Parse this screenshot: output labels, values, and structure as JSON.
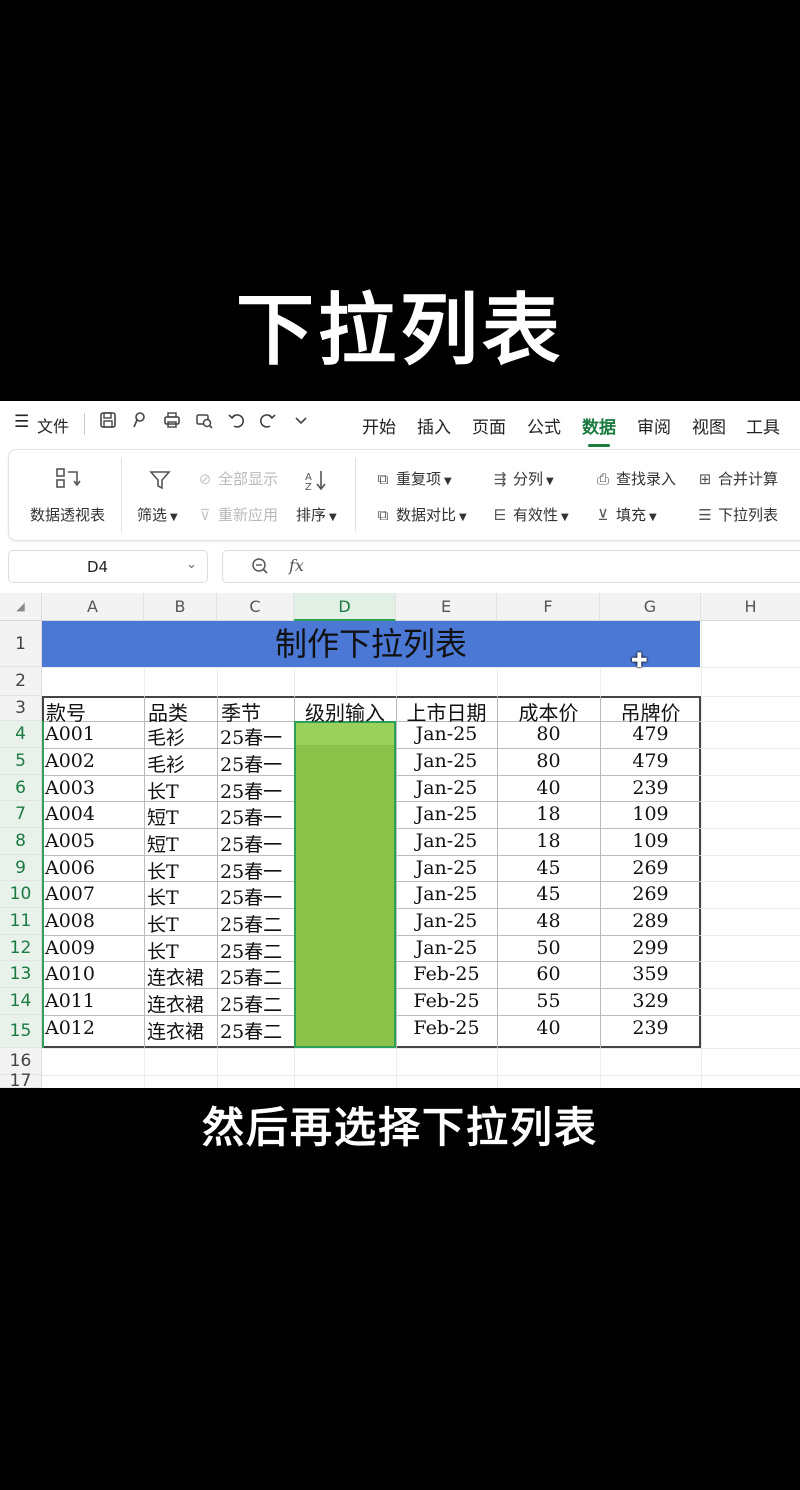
{
  "headline": "下拉列表",
  "subtitle": "然后再选择下拉列表",
  "menubar": {
    "menu_icon": "☰",
    "file_label": "文件",
    "quick_icons": [
      "save-icon",
      "format-painter-icon",
      "print-icon",
      "print-preview-icon",
      "undo-icon",
      "redo-icon",
      "more-icon"
    ],
    "tabs": [
      "开始",
      "插入",
      "页面",
      "公式",
      "数据",
      "审阅",
      "视图",
      "工具"
    ],
    "active_tab": "数据"
  },
  "ribbon": {
    "pivot": "数据透视表",
    "filter": "筛选",
    "show_all": "全部显示",
    "reapply": "重新应用",
    "sort": "排序",
    "duplicates": "重复项",
    "compare": "数据对比",
    "split": "分列",
    "validity": "有效性",
    "lookup_entry": "查找录入",
    "fill": "填充",
    "merge_calc": "合并计算",
    "dropdown_list": "下拉列表"
  },
  "formula_bar": {
    "cell_ref": "D4",
    "fx": "fx",
    "value": ""
  },
  "sheet": {
    "columns": [
      "A",
      "B",
      "C",
      "D",
      "E",
      "F",
      "G",
      "H"
    ],
    "selected_column": "D",
    "rows": [
      "1",
      "2",
      "3",
      "4",
      "5",
      "6",
      "7",
      "8",
      "9",
      "10",
      "11",
      "12",
      "13",
      "14",
      "15",
      "16",
      "17"
    ],
    "title": "制作下拉列表",
    "headers": [
      "款号",
      "品类",
      "季节",
      "级别输入",
      "上市日期",
      "成本价",
      "吊牌价"
    ],
    "data": [
      [
        "A001",
        "毛衫",
        "25春一",
        "",
        "Jan-25",
        "80",
        "479"
      ],
      [
        "A002",
        "毛衫",
        "25春一",
        "",
        "Jan-25",
        "80",
        "479"
      ],
      [
        "A003",
        "长T",
        "25春一",
        "",
        "Jan-25",
        "40",
        "239"
      ],
      [
        "A004",
        "短T",
        "25春一",
        "",
        "Jan-25",
        "18",
        "109"
      ],
      [
        "A005",
        "短T",
        "25春一",
        "",
        "Jan-25",
        "18",
        "109"
      ],
      [
        "A006",
        "长T",
        "25春一",
        "",
        "Jan-25",
        "45",
        "269"
      ],
      [
        "A007",
        "长T",
        "25春一",
        "",
        "Jan-25",
        "45",
        "269"
      ],
      [
        "A008",
        "长T",
        "25春二",
        "",
        "Jan-25",
        "48",
        "289"
      ],
      [
        "A009",
        "长T",
        "25春二",
        "",
        "Jan-25",
        "50",
        "299"
      ],
      [
        "A010",
        "连衣裙",
        "25春二",
        "",
        "Feb-25",
        "60",
        "359"
      ],
      [
        "A011",
        "连衣裙",
        "25春二",
        "",
        "Feb-25",
        "55",
        "329"
      ],
      [
        "A012",
        "连衣裙",
        "25春二",
        "",
        "Feb-25",
        "40",
        "239"
      ]
    ]
  },
  "colors": {
    "accent": "#1a7a3f",
    "title_fill": "#4a78d4",
    "selection_fill": "#8bc34a"
  }
}
